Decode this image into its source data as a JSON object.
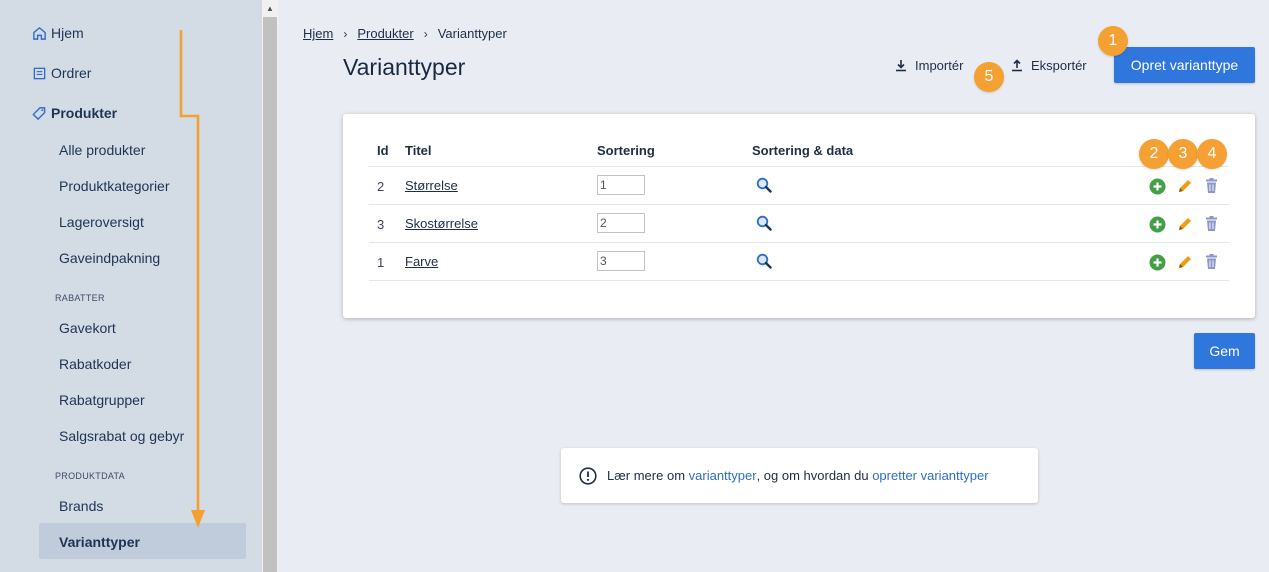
{
  "sidebar": {
    "top_items": [
      {
        "label": "Hjem",
        "icon": "home-icon"
      },
      {
        "label": "Ordrer",
        "icon": "orders-icon"
      },
      {
        "label": "Produkter",
        "icon": "tag-icon"
      }
    ],
    "product_items": [
      "Alle produkter",
      "Produktkategorier",
      "Lageroversigt",
      "Gaveindpakning"
    ],
    "section_rabatter": "RABATTER",
    "rabatter_items": [
      "Gavekort",
      "Rabatkoder",
      "Rabatgrupper",
      "Salgsrabat og gebyr"
    ],
    "section_produktdata": "PRODUKTDATA",
    "produktdata_items": [
      "Brands",
      "Varianttyper"
    ]
  },
  "breadcrumb": [
    "Hjem",
    "Produkter",
    "Varianttyper"
  ],
  "page": {
    "title": "Varianttyper",
    "import_label": "Importér",
    "export_label": "Eksportér",
    "create_label": "Opret varianttype",
    "save_label": "Gem"
  },
  "table": {
    "headers": [
      "Id",
      "Titel",
      "Sortering",
      "Sortering & data"
    ],
    "rows": [
      {
        "id": "2",
        "title": "Størrelse",
        "sort": "1"
      },
      {
        "id": "3",
        "title": "Skostørrelse",
        "sort": "2"
      },
      {
        "id": "1",
        "title": "Farve",
        "sort": "3"
      }
    ]
  },
  "badges": [
    "1",
    "2",
    "3",
    "4",
    "5"
  ],
  "info": {
    "prefix": "Lær mere om ",
    "link1": "varianttyper",
    "middle": ", og om hvordan du ",
    "link2": "opretter varianttyper"
  },
  "colors": {
    "primary": "#2f76dd",
    "badge": "#f5a033",
    "add": "#43a047",
    "edit": "#f39c12",
    "delete": "#8e97c8"
  }
}
